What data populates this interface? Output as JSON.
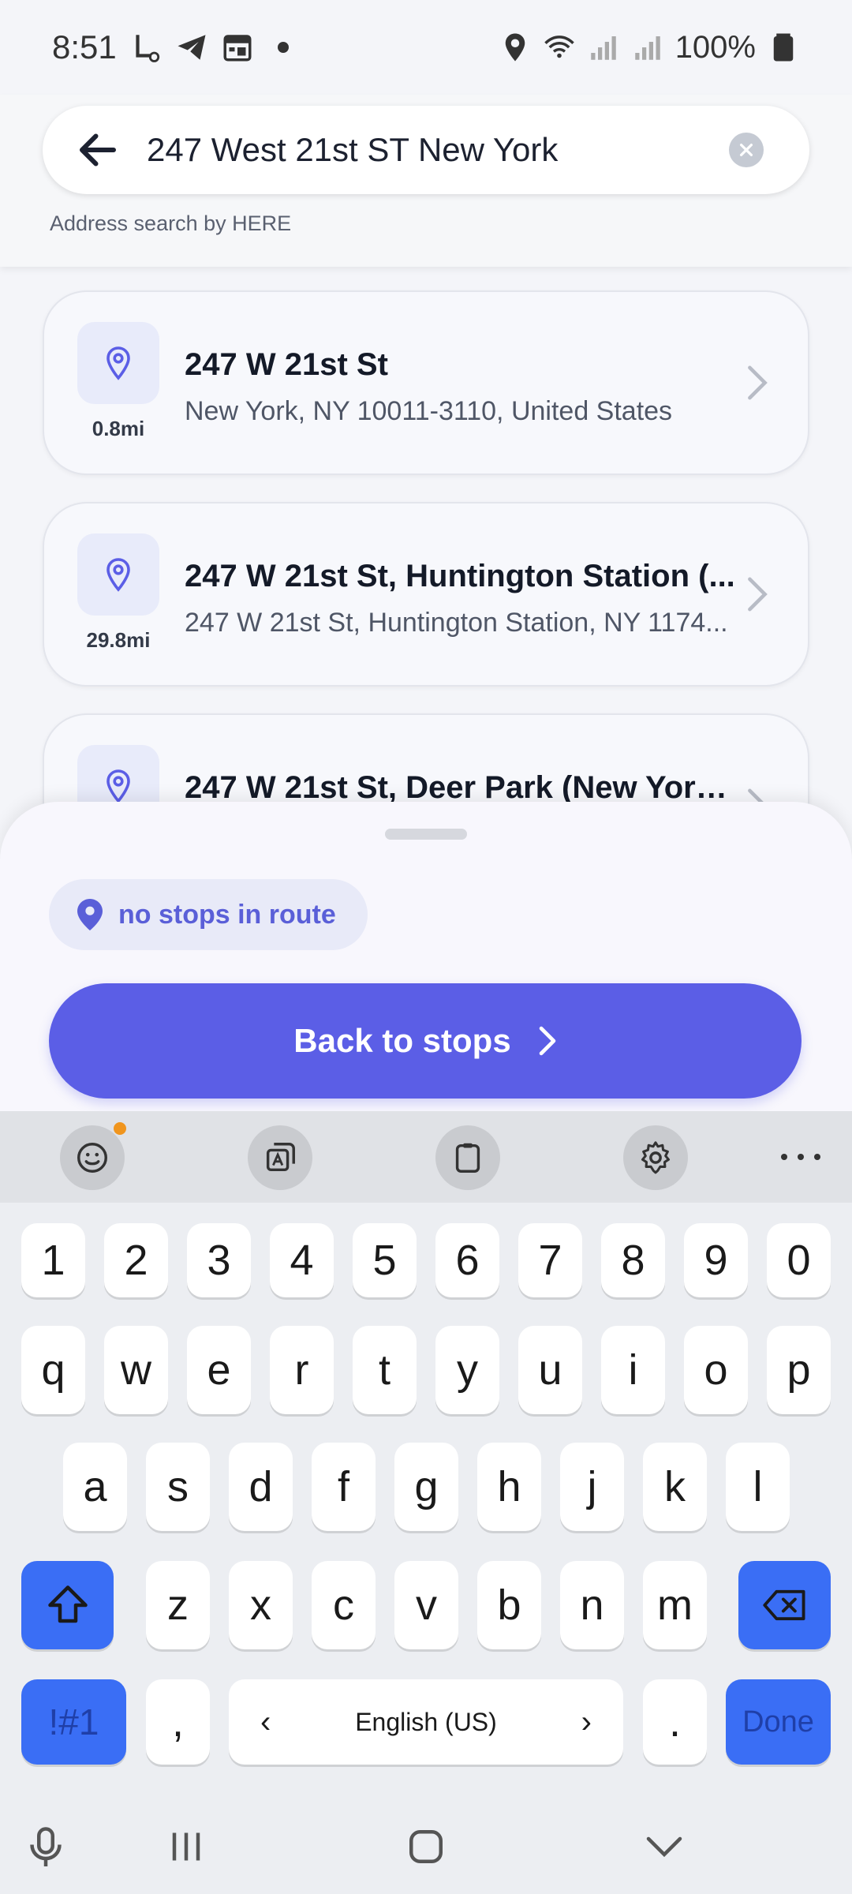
{
  "status_bar": {
    "time": "8:51",
    "battery": "100%"
  },
  "search": {
    "value": "247 West 21st ST New York",
    "powered_by": "Address search by HERE"
  },
  "results": [
    {
      "title": "247 W 21st St",
      "subtitle": "New York, NY 10011-3110, United States",
      "distance": "0.8mi"
    },
    {
      "title": "247 W 21st St, Huntington Station (...",
      "subtitle": "247 W 21st St, Huntington Station, NY 1174...",
      "distance": "29.8mi"
    },
    {
      "title": "247 W 21st St, Deer Park (New York...",
      "subtitle": "",
      "distance": ""
    }
  ],
  "sheet": {
    "chip_label": "no stops in route",
    "back_button_label": "Back to stops"
  },
  "keyboard": {
    "number_row": [
      "1",
      "2",
      "3",
      "4",
      "5",
      "6",
      "7",
      "8",
      "9",
      "0"
    ],
    "row1": [
      "q",
      "w",
      "e",
      "r",
      "t",
      "y",
      "u",
      "i",
      "o",
      "p"
    ],
    "row2": [
      "a",
      "s",
      "d",
      "f",
      "g",
      "h",
      "j",
      "k",
      "l"
    ],
    "row3": [
      "z",
      "x",
      "c",
      "v",
      "b",
      "n",
      "m"
    ],
    "symbols_label": "!#1",
    "comma": ",",
    "language": "English (US)",
    "period": ".",
    "done_label": "Done"
  },
  "colors": {
    "accent": "#5b5ee6",
    "keyboard_blue": "#3a6ef5",
    "chip_bg": "#e8eaf8"
  }
}
